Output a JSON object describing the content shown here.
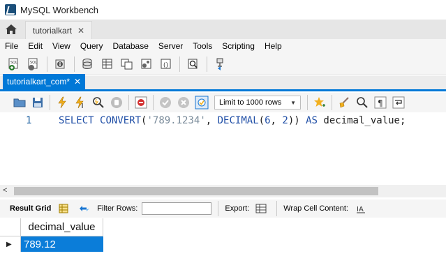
{
  "window": {
    "title": "MySQL Workbench"
  },
  "connection_tab": {
    "label": "tutorialkart",
    "close": "✕"
  },
  "menu": {
    "items": [
      "File",
      "Edit",
      "View",
      "Query",
      "Database",
      "Server",
      "Tools",
      "Scripting",
      "Help"
    ]
  },
  "editor_tab": {
    "label": "tutorialkart_com*",
    "close": "✕"
  },
  "sql_toolbar": {
    "limit_label": "Limit to 1000 rows"
  },
  "editor": {
    "line_number": "1",
    "tokens": {
      "select": "SELECT",
      "convert": "CONVERT",
      "open_paren": "(",
      "string": "'789.1234'",
      "comma1": ", ",
      "decimal": "DECIMAL",
      "open_paren2": "(",
      "num6": "6",
      "comma2": ", ",
      "num2": "2",
      "close_parens": "))",
      "as": "AS",
      "alias": "decimal_value;"
    }
  },
  "result_toolbar": {
    "result_grid": "Result Grid",
    "filter_rows": "Filter Rows:",
    "export": "Export:",
    "wrap": "Wrap Cell Content:"
  },
  "grid": {
    "columns": [
      "decimal_value"
    ],
    "rows": [
      [
        "789.12"
      ]
    ],
    "row_indicator": "▶"
  },
  "colors": {
    "accent": "#0078d7",
    "selection": "#0b7dd9",
    "keyword": "#1f4ea6"
  }
}
